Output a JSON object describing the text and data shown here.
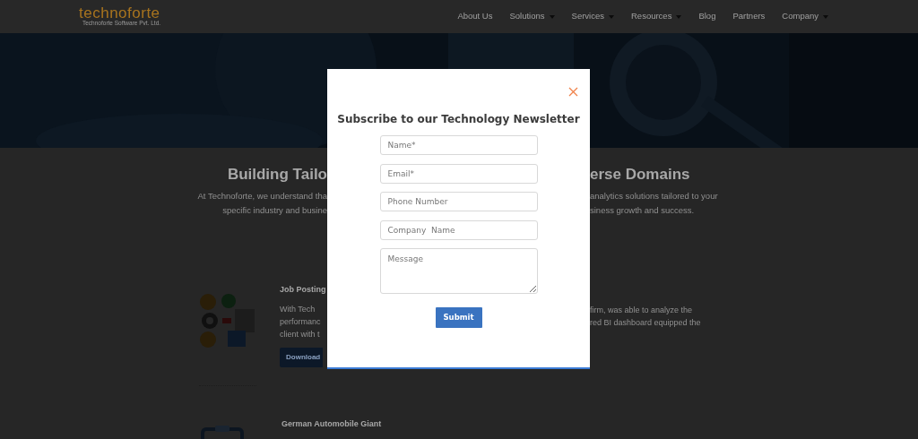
{
  "navbar": {
    "logo": "technoforte",
    "tagline": "Technoforte Software Pvt. Ltd.",
    "links": [
      {
        "label": "About Us",
        "dropdown": false
      },
      {
        "label": "Solutions",
        "dropdown": true
      },
      {
        "label": "Services",
        "dropdown": true
      },
      {
        "label": "Resources",
        "dropdown": true
      },
      {
        "label": "Blog",
        "dropdown": false
      },
      {
        "label": "Partners",
        "dropdown": false
      },
      {
        "label": "Company",
        "dropdown": true
      }
    ]
  },
  "intro": {
    "heading_left": "Building Tailo",
    "heading_right": "erse Domains",
    "paragraph_left": [
      "At Technoforte, we understand tha",
      "specific industry and busine"
    ],
    "paragraph_right": [
      "analytics solutions tailored to your",
      "siness growth and success."
    ]
  },
  "case_studies": [
    {
      "title": "Job Posting",
      "text_left": [
        "With Tech",
        "performanc",
        "client with t"
      ],
      "text_right": [
        "firm, was able to analyze the",
        "red BI dashboard equipped the"
      ],
      "button": "Download"
    },
    {
      "title": "German Automobile Giant"
    }
  ],
  "modal": {
    "title": "Subscribe to our Technology Newsletter",
    "fields": [
      {
        "kind": "input",
        "placeholder": "Name*"
      },
      {
        "kind": "input",
        "placeholder": "Email*"
      },
      {
        "kind": "input",
        "placeholder": "Phone Number"
      },
      {
        "kind": "input",
        "placeholder": "Company  Name"
      },
      {
        "kind": "textarea",
        "placeholder": "Message"
      }
    ],
    "submit": "Submit"
  }
}
